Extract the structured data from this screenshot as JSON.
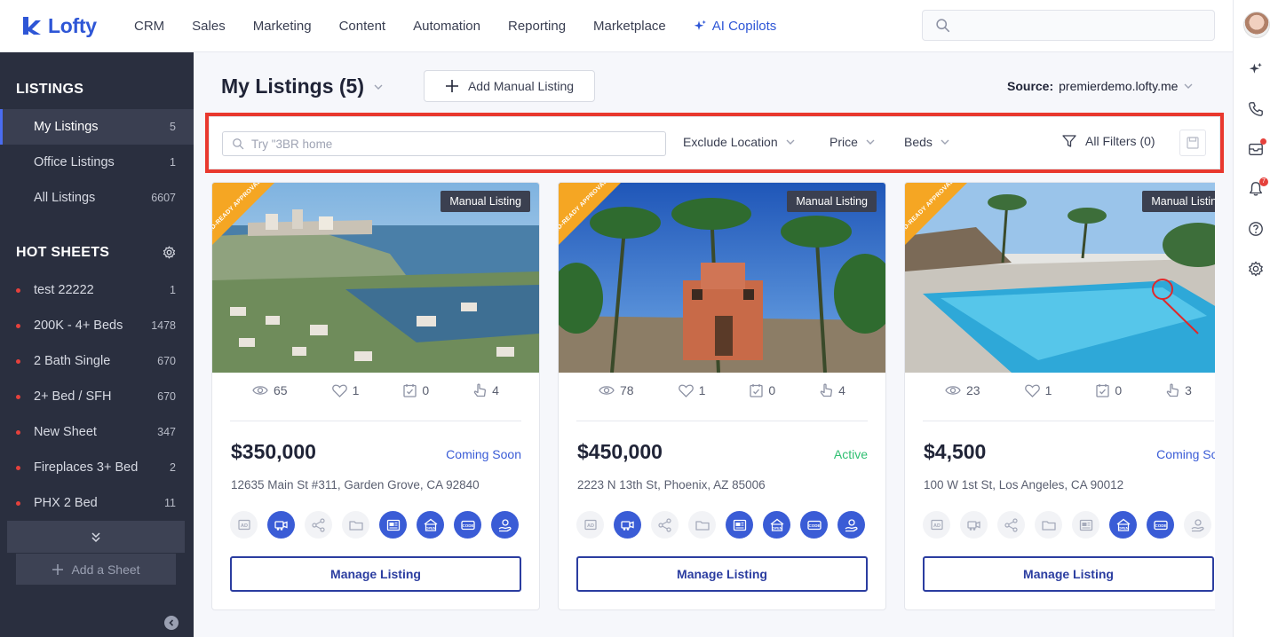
{
  "app": {
    "name": "Lofty"
  },
  "nav": [
    "CRM",
    "Sales",
    "Marketing",
    "Content",
    "Automation",
    "Reporting",
    "Marketplace"
  ],
  "nav_ai": "AI Copilots",
  "sidebar": {
    "listings_heading": "LISTINGS",
    "listings": [
      {
        "label": "My Listings",
        "count": "5",
        "active": true
      },
      {
        "label": "Office Listings",
        "count": "1"
      },
      {
        "label": "All Listings",
        "count": "6607"
      }
    ],
    "hot_heading": "HOT SHEETS",
    "hot_sheets": [
      {
        "label": "test 22222",
        "count": "1"
      },
      {
        "label": "200K - 4+ Beds",
        "count": "1478"
      },
      {
        "label": "2 Bath Single",
        "count": "670"
      },
      {
        "label": "2+ Bed / SFH",
        "count": "670"
      },
      {
        "label": "New Sheet",
        "count": "347"
      },
      {
        "label": "Fireplaces 3+ Bed",
        "count": "2"
      },
      {
        "label": "PHX 2 Bed",
        "count": "11"
      }
    ],
    "add_sheet": "Add a Sheet"
  },
  "header": {
    "title": "My Listings (5)",
    "add_manual": "Add Manual Listing",
    "source_label": "Source:",
    "source_value": "premierdemo.lofty.me"
  },
  "filters": {
    "search_value": "Try \"3BR home",
    "exclude_location": "Exclude Location",
    "price": "Price",
    "beds": "Beds",
    "all_filters": "All Filters (0)"
  },
  "notifications": {
    "count": "7"
  },
  "colors": {
    "accent": "#3a5cd6",
    "coming_soon": "#3a5cd6",
    "active": "#2fbf71",
    "ribbon": "#f5a623",
    "highlight": "#e9382e"
  },
  "cards": [
    {
      "tag": "Manual Listing",
      "ribbon": "AD-READY APPROVAL",
      "views": "65",
      "likes": "1",
      "saves": "0",
      "shares": "4",
      "price": "$350,000",
      "status": "Coming Soon",
      "status_color": "#3a5cd6",
      "address": "12635 Main St #311, Garden Grove, CA 92840",
      "tools_on": [
        false,
        true,
        false,
        false,
        true,
        true,
        true,
        true
      ],
      "manage": "Manage Listing"
    },
    {
      "tag": "Manual Listing",
      "ribbon": "AD-READY APPROVAL",
      "views": "78",
      "likes": "1",
      "saves": "0",
      "shares": "4",
      "price": "$450,000",
      "status": "Active",
      "status_color": "#2fbf71",
      "address": "2223 N 13th St, Phoenix, AZ 85006",
      "tools_on": [
        false,
        true,
        false,
        false,
        true,
        true,
        true,
        true
      ],
      "manage": "Manage Listing"
    },
    {
      "tag": "Manual Listing",
      "ribbon": "AD-READY APPROVAL",
      "views": "23",
      "likes": "1",
      "saves": "0",
      "shares": "3",
      "price": "$4,500",
      "status": "Coming Soon",
      "status_color": "#3a5cd6",
      "address": "100 W 1st St, Los Angeles, CA 90012",
      "tools_on": [
        false,
        false,
        false,
        false,
        false,
        true,
        true,
        false
      ],
      "manage": "Manage Listing"
    }
  ]
}
